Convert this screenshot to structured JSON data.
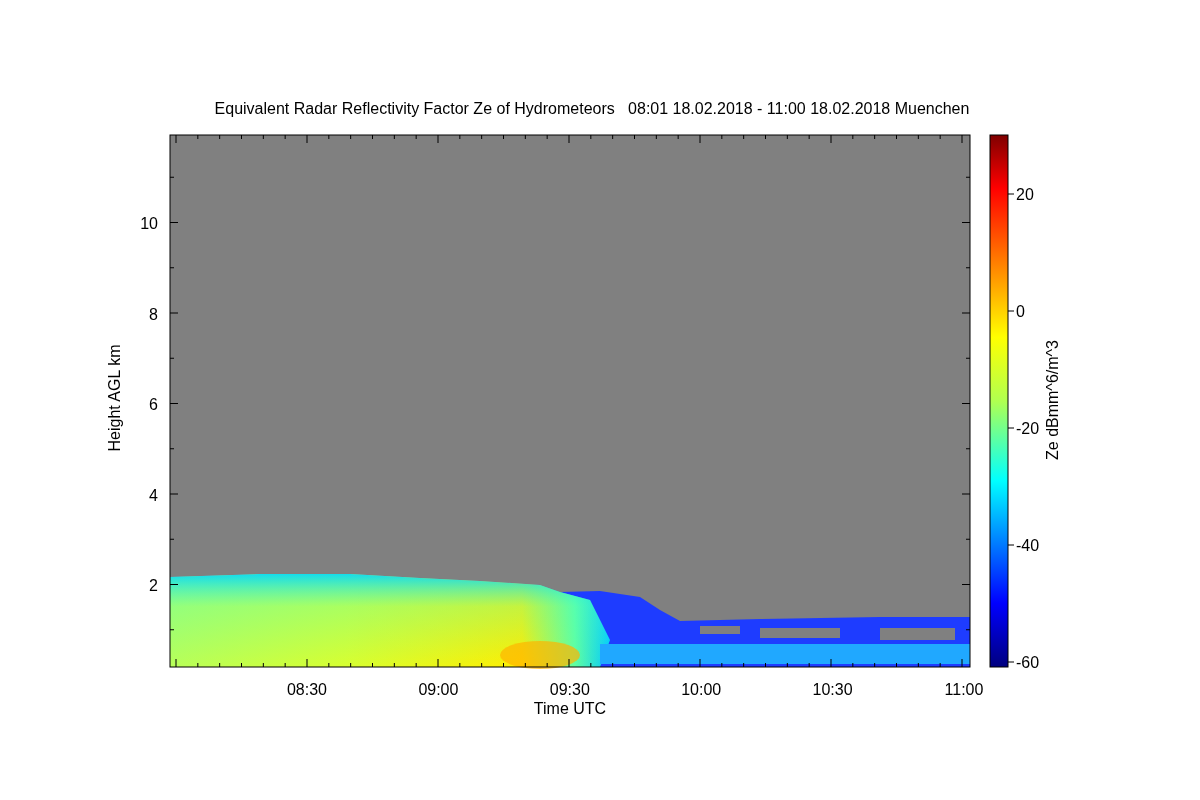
{
  "title": "Equivalent Radar Reflectivity Factor Ze of Hydrometeors   08:01 18.02.2018 - 11:00 18.02.2018 Muenchen",
  "plot": {
    "ylabel": "Height AGL km",
    "xlabel": "Time UTC",
    "yticks": [
      "10",
      "8",
      "6",
      "4",
      "2"
    ],
    "xticks": [
      "08:30",
      "09:00",
      "09:30",
      "10:00",
      "10:30",
      "11:00"
    ]
  },
  "colorbar": {
    "label": "Ze dBmm^6/m^3",
    "ticks": [
      "20",
      "0",
      "-20",
      "-40",
      "-60"
    ]
  }
}
